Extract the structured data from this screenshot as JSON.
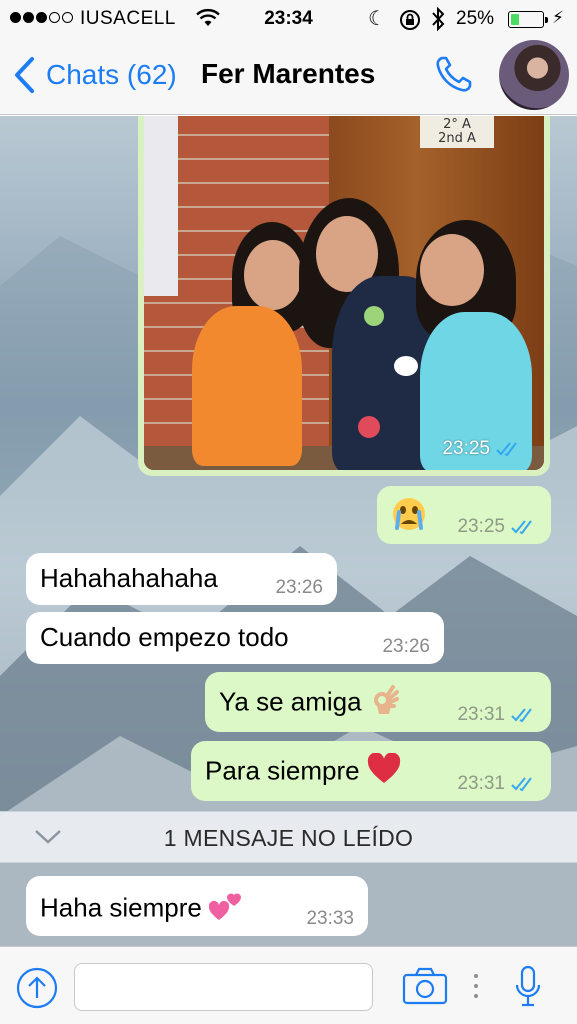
{
  "status": {
    "carrier": "IUSACELL",
    "time": "23:34",
    "battery_pct": "25%",
    "battery_level": 0.25,
    "icons": [
      "signal-dots",
      "wifi-icon",
      "moon-icon",
      "rotation-lock-icon",
      "bluetooth-icon",
      "battery-icon",
      "charging-bolt-icon"
    ]
  },
  "nav": {
    "back_label": "Chats (62)",
    "contact_name": "Fer Marentes",
    "call_icon": "phone-icon"
  },
  "photo": {
    "sign_text_1": "2° A",
    "sign_text_2": "2nd A",
    "time": "23:25"
  },
  "messages": [
    {
      "dir": "out",
      "text": "",
      "emoji": "crying-face",
      "time": "23:25"
    },
    {
      "dir": "in",
      "text": "Hahahahahaha",
      "time": "23:26"
    },
    {
      "dir": "in",
      "text": "Cuando empezo todo",
      "time": "23:26"
    },
    {
      "dir": "out",
      "text": "Ya se amiga",
      "emoji": "ok-hand",
      "time": "23:31"
    },
    {
      "dir": "out",
      "text": "Para siempre",
      "emoji": "red-heart",
      "time": "23:31"
    },
    {
      "dir": "in",
      "text": "Haha siempre",
      "emoji": "two-hearts",
      "time": "23:33"
    }
  ],
  "unread_label": "1 MENSAJE NO LEÍDO",
  "input": {
    "placeholder": ""
  },
  "colors": {
    "accent": "#1c7cf4",
    "outgoing_bubble": "#dcf8c6",
    "incoming_bubble": "#ffffff",
    "read_ticks": "#34a8f0"
  }
}
